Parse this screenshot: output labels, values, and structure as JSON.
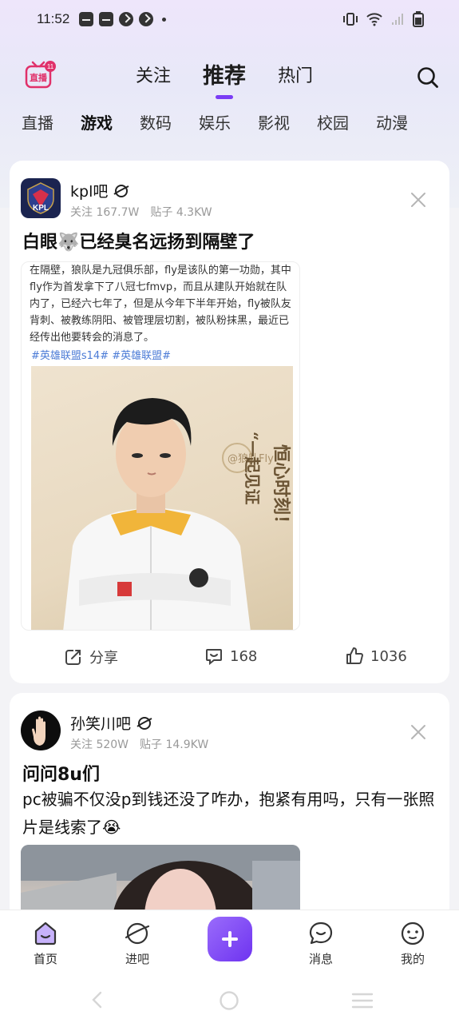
{
  "status_bar": {
    "time": "11:52"
  },
  "header": {
    "live_logo_text": "直播",
    "tabs": [
      {
        "label": "关注",
        "active": false
      },
      {
        "label": "推荐",
        "active": true
      },
      {
        "label": "热门",
        "active": false
      }
    ]
  },
  "categories": [
    {
      "label": "直播",
      "active": false
    },
    {
      "label": "游戏",
      "active": true
    },
    {
      "label": "数码",
      "active": false
    },
    {
      "label": "娱乐",
      "active": false
    },
    {
      "label": "影视",
      "active": false
    },
    {
      "label": "校园",
      "active": false
    },
    {
      "label": "动漫",
      "active": false
    }
  ],
  "posts": [
    {
      "bar_name": "kpl吧",
      "followers": "关注 167.7W",
      "post_count": "贴子 4.3KW",
      "title": "白眼🐺已经臭名远扬到隔壁了",
      "image_text": "在隔壁，狼队是九冠俱乐部，fly是该队的第一功勋，其中fly作为首发拿下了八冠七fmvp，而且从建队开始就在队内了，已经六七年了，但是从今年下半年开始，fly被队友背刺、被教练阴阳、被管理层切割，被队粉抹黑，最近已经传出他要转会的消息了。",
      "image_tags": "#英雄联盟s14# #英雄联盟#",
      "photo_caption_1": "@狼队Fly",
      "photo_caption_2": "“一起见证",
      "photo_caption_3": "恒心时刻！",
      "share_label": "分享",
      "comments": "168",
      "likes": "1036"
    },
    {
      "bar_name": "孙笑川吧",
      "followers": "关注 520W",
      "post_count": "贴子 14.9KW",
      "title": "问问8u们",
      "body": "pc被骗不仅没p到钱还没了咋办，抱紧有用吗，只有一张照片是线索了😭"
    }
  ],
  "bottom_nav": [
    {
      "label": "首页"
    },
    {
      "label": "进吧"
    },
    {
      "label": "消息"
    },
    {
      "label": "我的"
    }
  ],
  "colors": {
    "accent": "#7a3cf5",
    "live_logo": "#e0306a"
  }
}
